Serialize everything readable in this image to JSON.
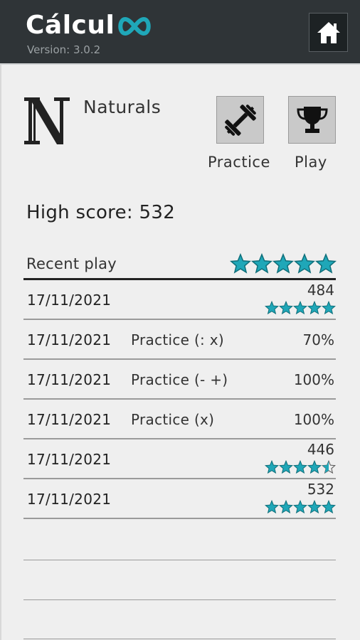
{
  "app": {
    "name": "Cálcul",
    "logo_symbol": "infinity-icon",
    "version": "Version: 3.0.2"
  },
  "header": {
    "home_icon": "home-icon"
  },
  "mode": {
    "title": "Naturals",
    "logo_icon": "naturals-set-icon"
  },
  "actions": {
    "practice": {
      "label": "Practice",
      "icon": "dumbbell-icon"
    },
    "play": {
      "label": "Play",
      "icon": "trophy-icon"
    }
  },
  "high_score": "High score: 532",
  "recent": {
    "header": "Recent play",
    "header_rating": 5,
    "rows": [
      {
        "date": "17/11/2021",
        "mode": "",
        "result": "",
        "score": "484",
        "rating": 5
      },
      {
        "date": "17/11/2021",
        "mode": "Practice  (: x)",
        "result": "70%",
        "score": "",
        "rating": null
      },
      {
        "date": "17/11/2021",
        "mode": "Practice  (- +)",
        "result": "100%",
        "score": "",
        "rating": null
      },
      {
        "date": "17/11/2021",
        "mode": "Practice  (x)",
        "result": "100%",
        "score": "",
        "rating": null
      },
      {
        "date": "17/11/2021",
        "mode": "",
        "result": "",
        "score": "446",
        "rating": 4.5
      },
      {
        "date": "17/11/2021",
        "mode": "",
        "result": "",
        "score": "532",
        "rating": 5
      }
    ]
  },
  "colors": {
    "topbar": "#2f3437",
    "accent": "#1fa7b8",
    "background": "#efefef"
  }
}
